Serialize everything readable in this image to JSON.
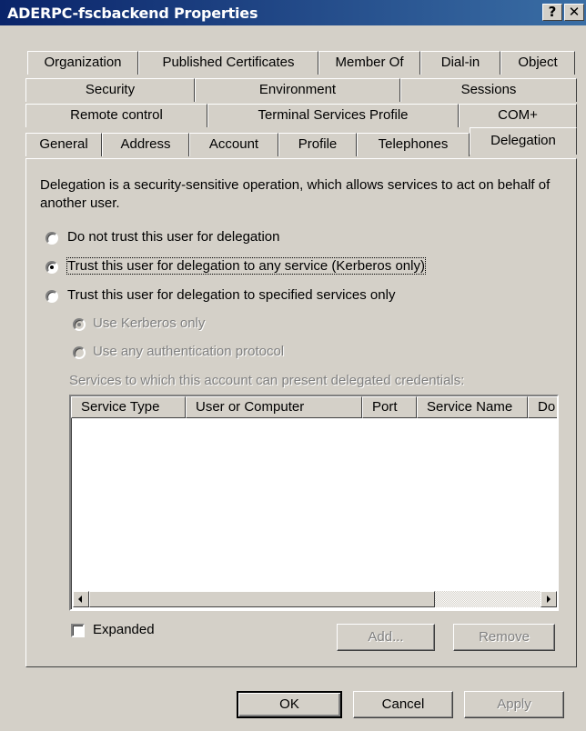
{
  "window": {
    "title": "ADERPC-fscbackend Properties",
    "help_btn": "?",
    "close_btn": "✕"
  },
  "tabs": {
    "row1": [
      "Organization",
      "Published Certificates",
      "Member Of",
      "Dial-in",
      "Object"
    ],
    "row2": [
      "Security",
      "Environment",
      "Sessions"
    ],
    "row3": [
      "Remote control",
      "Terminal Services Profile",
      "COM+"
    ],
    "row4": [
      "General",
      "Address",
      "Account",
      "Profile",
      "Telephones",
      "Delegation"
    ],
    "active": "Delegation"
  },
  "delegation": {
    "description": "Delegation is a security-sensitive operation, which allows services to act on behalf of another user.",
    "options": [
      {
        "label": "Do not trust this user for delegation",
        "selected": false
      },
      {
        "label": "Trust this user for delegation to any service (Kerberos only)",
        "selected": true
      },
      {
        "label": "Trust this user for delegation to specified services only",
        "selected": false
      }
    ],
    "suboptions": [
      {
        "label": "Use Kerberos only",
        "selected": true,
        "enabled": false
      },
      {
        "label": "Use any authentication protocol",
        "selected": false,
        "enabled": false
      }
    ],
    "services_caption": "Services to which this account can present delegated credentials:",
    "columns": [
      "Service Type",
      "User or Computer",
      "Port",
      "Service Name",
      "Do"
    ],
    "expanded_label": "Expanded",
    "add_label": "Add...",
    "remove_label": "Remove"
  },
  "footer": {
    "ok": "OK",
    "cancel": "Cancel",
    "apply": "Apply"
  },
  "colors": {
    "titlebar_start": "#0a246a",
    "titlebar_end": "#3a6ea5",
    "face": "#d4d0c8",
    "disabled_text": "#808080"
  }
}
